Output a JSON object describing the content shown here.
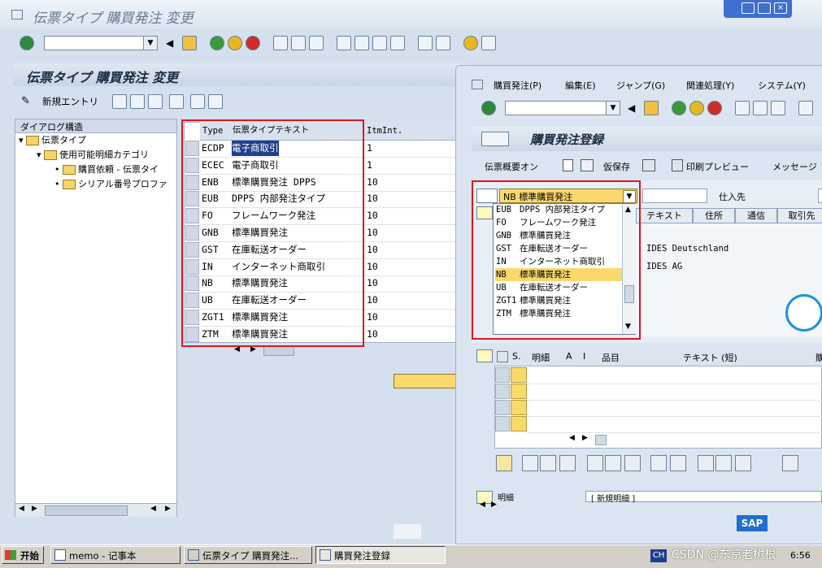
{
  "main_window": {
    "title": "伝票タイプ 購買発注 変更",
    "screen_title": "伝票タイプ 購買発注 変更",
    "new_entries_label": "新規エントリ",
    "tree": {
      "header": "ダイアログ構造",
      "items": [
        {
          "label": "伝票タイプ"
        },
        {
          "label": "使用可能明細カテゴリ"
        },
        {
          "label": "購買依頼 - 伝票タイ"
        },
        {
          "label": "シリアル番号プロファ"
        }
      ]
    },
    "table": {
      "headers": [
        "Type",
        "伝票タイプテキスト",
        "ItmInt."
      ],
      "rows": [
        {
          "type": "ECDP",
          "text": "電子商取引",
          "itm": "1"
        },
        {
          "type": "ECEC",
          "text": "電子商取引",
          "itm": "1"
        },
        {
          "type": "ENB",
          "text": "標準購買発注 DPPS",
          "itm": "10"
        },
        {
          "type": "EUB",
          "text": "DPPS 内部発注タイプ",
          "itm": "10"
        },
        {
          "type": "FO",
          "text": "フレームワーク発注",
          "itm": "10"
        },
        {
          "type": "GNB",
          "text": "標準購買発注",
          "itm": "10"
        },
        {
          "type": "GST",
          "text": "在庫転送オーダー",
          "itm": "10"
        },
        {
          "type": "IN",
          "text": "インターネット商取引",
          "itm": "10"
        },
        {
          "type": "NB",
          "text": "標準購買発注",
          "itm": "10"
        },
        {
          "type": "UB",
          "text": "在庫転送オーダー",
          "itm": "10"
        },
        {
          "type": "ZGT1",
          "text": "標準購買発注",
          "itm": "10"
        },
        {
          "type": "ZTM",
          "text": "標準購買発注",
          "itm": "10"
        }
      ]
    }
  },
  "po_window": {
    "menu": [
      "購買発注(P)",
      "編集(E)",
      "ジャンプ(G)",
      "関連処理(Y)",
      "システム(Y)"
    ],
    "screen_title": "購買発注登録",
    "toolbar": {
      "doc_overview": "伝票概要オン",
      "hold": "仮保存",
      "print_preview": "印刷プレビュー",
      "messages": "メッセージ"
    },
    "order_type_selected": "NB 標準購買発注",
    "vendor_label": "仕入先",
    "tabs": [
      "テキスト",
      "住所",
      "通信",
      "取引先"
    ],
    "org_values": [
      "IDES Deutschland",
      "IDES AG"
    ],
    "dropdown": [
      {
        "key": "EUB",
        "text": "DPPS 内部発注タイプ"
      },
      {
        "key": "FO",
        "text": "フレームワーク発注"
      },
      {
        "key": "GNB",
        "text": "標準購買発注"
      },
      {
        "key": "GST",
        "text": "在庫転送オーダー"
      },
      {
        "key": "IN",
        "text": "インターネット商取引"
      },
      {
        "key": "NB",
        "text": "標準購買発注"
      },
      {
        "key": "UB",
        "text": "在庫転送オーダー"
      },
      {
        "key": "ZGT1",
        "text": "標準購買発注"
      },
      {
        "key": "ZTM",
        "text": "標準購買発注"
      }
    ],
    "item_headers": [
      "S.",
      "明細",
      "A",
      "I",
      "品目",
      "テキスト (短)",
      "購"
    ],
    "bottom_field_label": "明細",
    "bottom_field_value": "[ 新規明細 ]"
  },
  "taskbar": {
    "start": "开始",
    "tasks": [
      "memo - 记事本",
      "伝票タイプ 購買発注...",
      "購買発注登録"
    ],
    "ime": "CH",
    "clock": "6:56",
    "watermark": "CSDN @东京老树根"
  },
  "colors": {
    "sap_bg": "#d4e0ee",
    "highlight_red": "#e0141e",
    "selected_row": "#fbd86b"
  }
}
